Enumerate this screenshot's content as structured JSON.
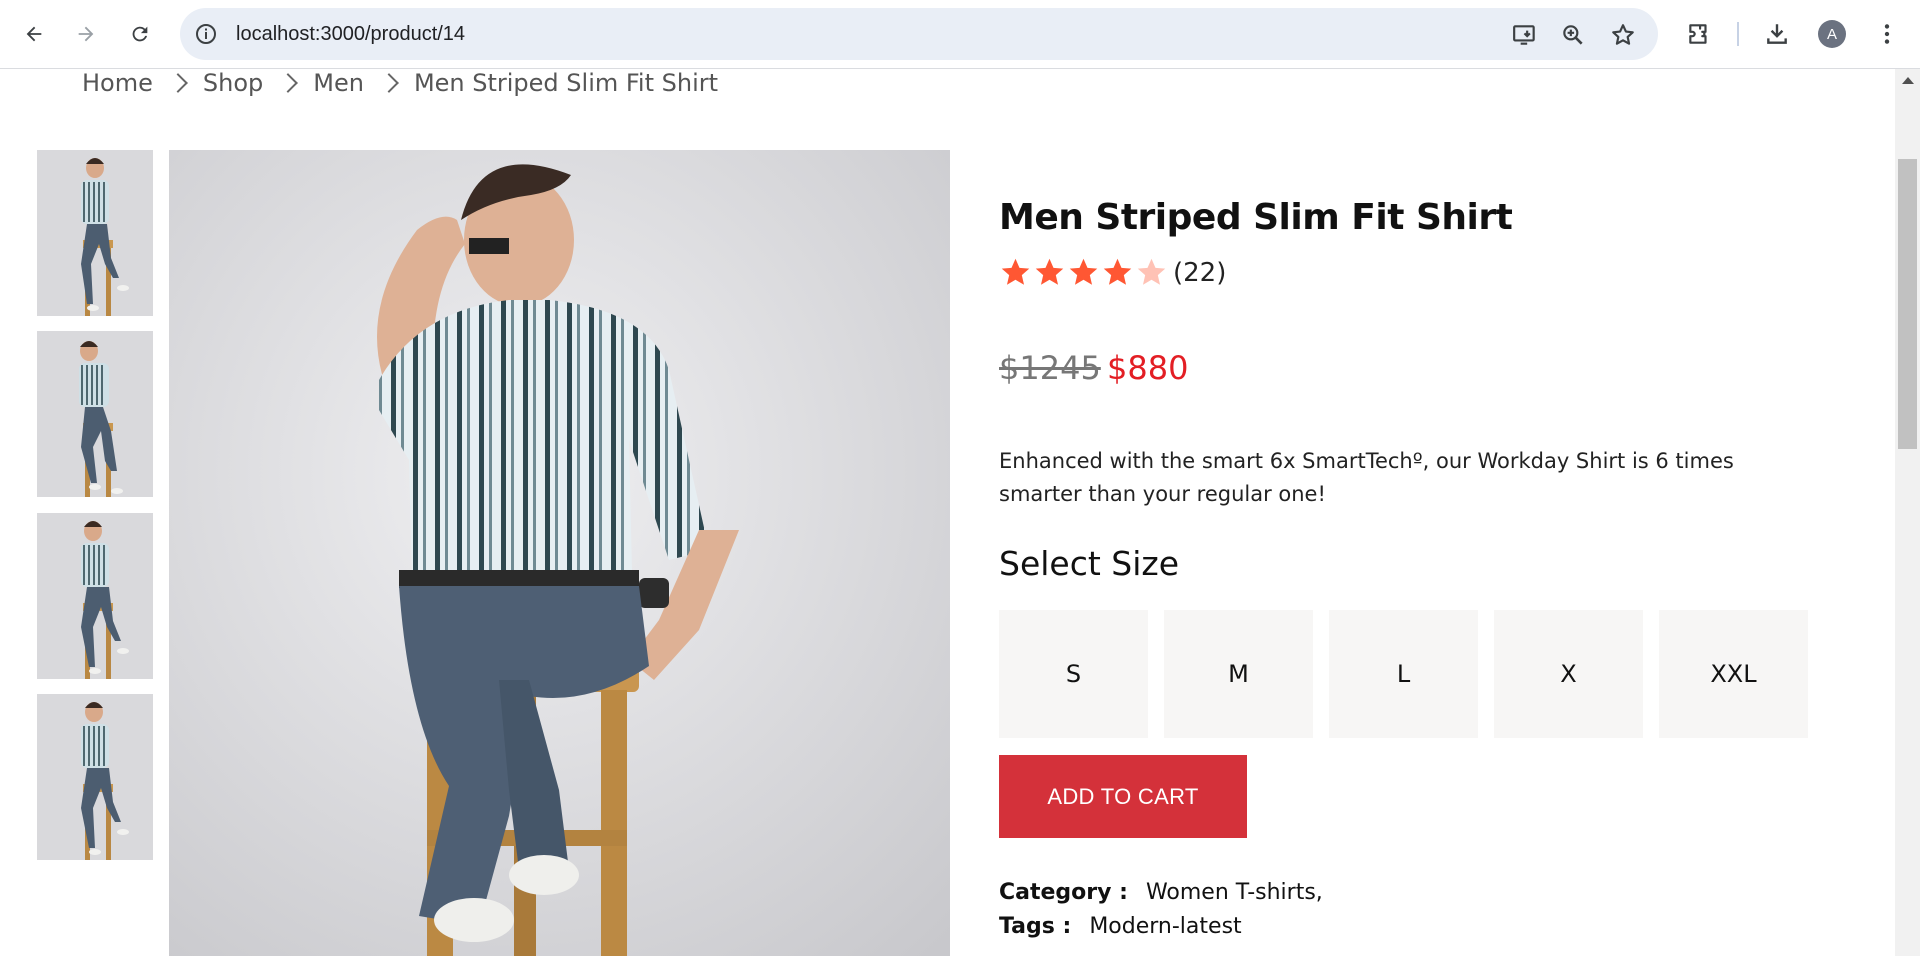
{
  "browser": {
    "url": "localhost:3000/product/14",
    "avatar_letter": "A"
  },
  "breadcrumb": [
    "Home",
    "Shop",
    "Men",
    "Men Striped Slim Fit Shirt"
  ],
  "product": {
    "title": "Men Striped Slim Fit Shirt",
    "rating": 4,
    "rating_max": 5,
    "review_count": "(22)",
    "price_old": "$1245",
    "price_new": "$880",
    "description": "Enhanced with the smart 6x SmartTechº, our Workday Shirt is 6 times smarter than your regular one!",
    "size_heading": "Select Size",
    "sizes": [
      "S",
      "M",
      "L",
      "X",
      "XXL"
    ],
    "add_to_cart": "ADD TO CART",
    "category_label": "Category :",
    "category_value": "Women T-shirts,",
    "tags_label": "Tags :",
    "tags_value": "Modern-latest"
  },
  "colors": {
    "accent_red": "#d4313a",
    "price_red": "#e31e24",
    "star_filled": "#ff5733",
    "star_empty": "#ffc2b5"
  }
}
